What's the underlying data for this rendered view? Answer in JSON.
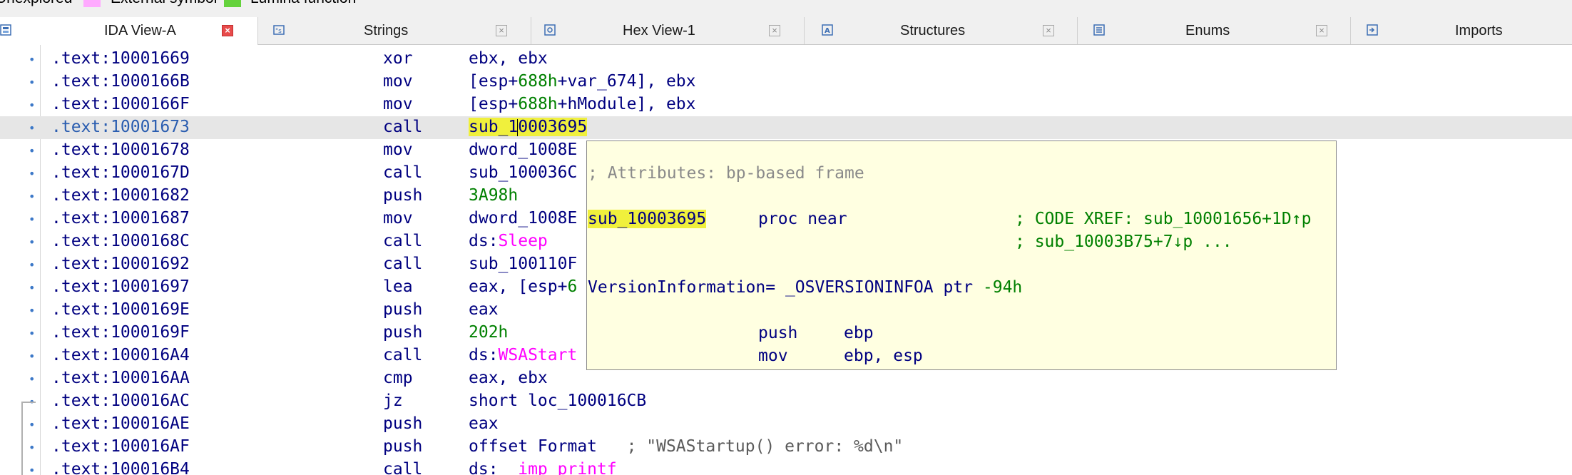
{
  "legend": {
    "items": [
      {
        "label": "Unexplored",
        "color": ""
      },
      {
        "label": "External symbol",
        "color": "#ffaaff"
      },
      {
        "label": "Lumina function",
        "color": "#64d23c"
      }
    ]
  },
  "tabs": [
    {
      "label": "IDA View-A",
      "icon": "graph-view-icon",
      "active": true
    },
    {
      "label": "Strings",
      "icon": "strings-window-icon",
      "active": false
    },
    {
      "label": "Hex View-1",
      "icon": "hex-view-icon",
      "active": false
    },
    {
      "label": "Structures",
      "icon": "structures-icon",
      "active": false
    },
    {
      "label": "Enums",
      "icon": "enums-icon",
      "active": false
    },
    {
      "label": "Imports",
      "icon": "imports-icon",
      "active": false
    }
  ],
  "disasm": {
    "rows": [
      {
        "addr": ".text:10001669",
        "mnem": "xor",
        "ops": "ebx, ebx"
      },
      {
        "addr": ".text:1000166B",
        "mnem": "mov",
        "ops_pre": "[esp+",
        "ops_num": "688h",
        "ops_post": "+var_674], ebx"
      },
      {
        "addr": ".text:1000166F",
        "mnem": "mov",
        "ops_pre": "[esp+",
        "ops_num": "688h",
        "ops_post": "+hModule], ebx"
      },
      {
        "addr": ".text:10001673",
        "mnem": "call",
        "ops_hl_a": "sub_1",
        "ops_hl_b": "0003695"
      },
      {
        "addr": ".text:10001678",
        "mnem": "mov",
        "ops": "dword_1008E"
      },
      {
        "addr": ".text:1000167D",
        "mnem": "call",
        "ops": "sub_100036C"
      },
      {
        "addr": ".text:10001682",
        "mnem": "push",
        "ops_num": "3A98h"
      },
      {
        "addr": ".text:10001687",
        "mnem": "mov",
        "ops": "dword_1008E"
      },
      {
        "addr": ".text:1000168C",
        "mnem": "call",
        "ops_pre": "ds:",
        "ops_imp": "Sleep"
      },
      {
        "addr": ".text:10001692",
        "mnem": "call",
        "ops": "sub_100110F"
      },
      {
        "addr": ".text:10001697",
        "mnem": "lea",
        "ops_pre": "eax, [esp+",
        "ops_num": "6"
      },
      {
        "addr": ".text:1000169E",
        "mnem": "push",
        "ops": "eax"
      },
      {
        "addr": ".text:1000169F",
        "mnem": "push",
        "ops_num": "202h"
      },
      {
        "addr": ".text:100016A4",
        "mnem": "call",
        "ops_pre": "ds:",
        "ops_imp": "WSAStart"
      },
      {
        "addr": ".text:100016AA",
        "mnem": "cmp",
        "ops": "eax, ebx"
      },
      {
        "addr": ".text:100016AC",
        "mnem": "jz",
        "ops": "short loc_100016CB"
      },
      {
        "addr": ".text:100016AE",
        "mnem": "push",
        "ops": "eax"
      },
      {
        "addr": ".text:100016AF",
        "mnem": "push",
        "ops": "offset Format   ",
        "ops_cmt": "; \"WSAStartup() error: %d\\n\""
      },
      {
        "addr": ".text:100016B4",
        "mnem": "call",
        "ops_pre": "ds:",
        "ops_imp": "__imp_printf"
      }
    ]
  },
  "popup": {
    "attributes_comment": "; Attributes: bp-based frame",
    "proc_name": "sub_10003695",
    "proc_decl": "proc near",
    "xref1": "; CODE XREF: sub_10001656+1D↑p",
    "xref2": "; sub_10003B75+7↓p ...",
    "var_decl": "VersionInformation= _OSVERSIONINFOA ptr ",
    "var_offset": "-94h",
    "instructions": [
      {
        "mnem": "push",
        "ops": "ebp"
      },
      {
        "mnem": "mov",
        "ops": "ebp, esp"
      }
    ]
  }
}
